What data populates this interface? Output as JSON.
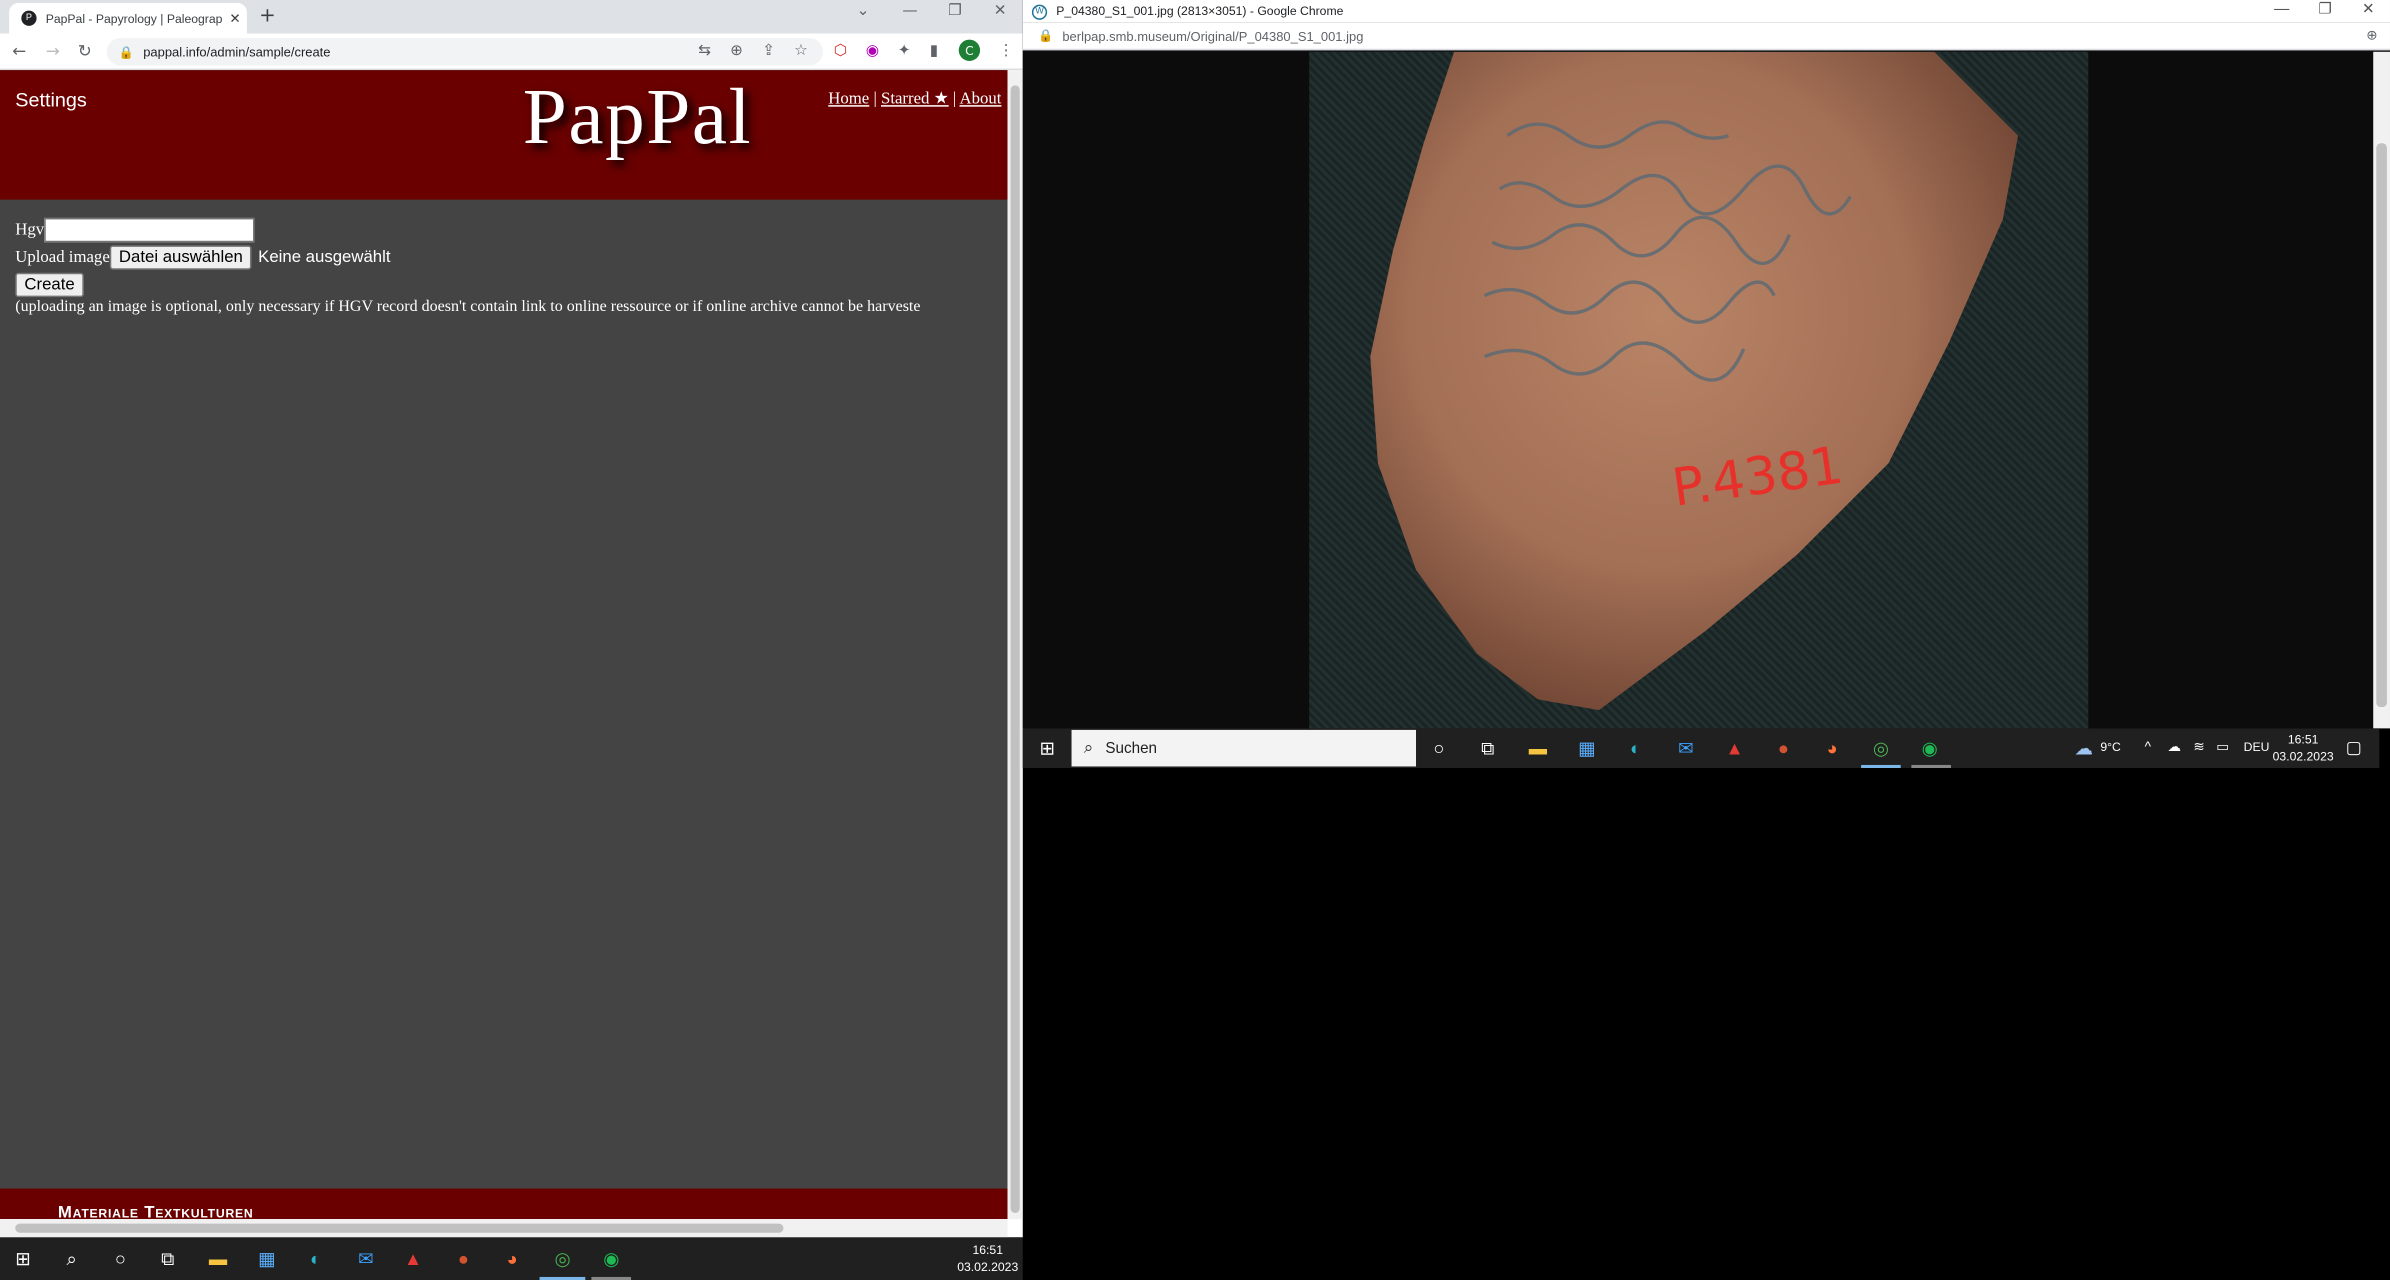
{
  "left_window": {
    "tab_title": "PapPal - Papyrology | Paleograph",
    "url": "pappal.info/admin/sample/create",
    "page": {
      "settings_label": "Settings",
      "logo_text": "PapPal",
      "nav": {
        "home": "Home",
        "separator": "|",
        "starred": "Starred ★",
        "about": "About"
      },
      "form": {
        "hgv_label": "Hgv",
        "hgv_value": "",
        "upload_label": "Upload image",
        "file_button": "Datei auswählen",
        "file_status": "Keine ausgewählt",
        "create_button": "Create",
        "note": "(uploading an image is optional, only necessary if HGV record doesn't contain link to online ressource or if online archive cannot be harveste"
      },
      "footer_text": "Materiale Textkulturen"
    },
    "colors": {
      "header_bg": "#6a0000",
      "page_bg": "#444444"
    }
  },
  "right_window": {
    "title": "P_04380_S1_001.jpg (2813×3051) - Google Chrome",
    "url": "berlpap.smb.museum/Original/P_04380_S1_001.jpg",
    "image_label": "P.4381",
    "taskbar": {
      "search_placeholder": "Suchen",
      "weather": "9°C",
      "language": "DEU",
      "time": "16:51",
      "date": "03.02.2023"
    }
  },
  "main_taskbar": {
    "time": "16:51",
    "date": "03.02.2023"
  },
  "icons": [
    "windows-start-icon",
    "search-icon",
    "cortana-icon",
    "task-view-icon",
    "file-explorer-icon",
    "store-icon",
    "edge-icon",
    "mail-icon",
    "acrobat-icon",
    "powerpoint-icon",
    "firefox-icon",
    "chrome-icon",
    "spotify-icon"
  ]
}
